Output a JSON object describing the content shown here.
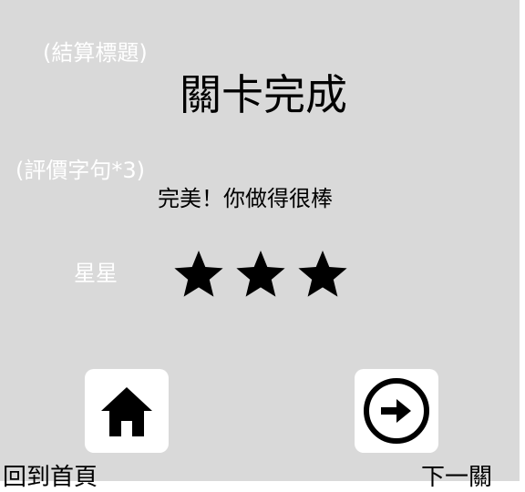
{
  "hints": {
    "title_hint": "(結算標題)",
    "praise_hint": "(評價字句*3)",
    "stars_hint": "星星"
  },
  "result": {
    "title": "關卡完成",
    "praise": "完美！你做得很棒",
    "stars_earned": 3,
    "stars_total": 3
  },
  "buttons": {
    "home": {
      "icon": "home-icon",
      "label": "回到首頁"
    },
    "next": {
      "icon": "arrow-right-circle-icon",
      "label": "下一關"
    }
  },
  "colors": {
    "panel_bg": "#d9d9d9",
    "hint_text": "#ffffff",
    "button_bg": "#ffffff",
    "icon": "#000000"
  }
}
